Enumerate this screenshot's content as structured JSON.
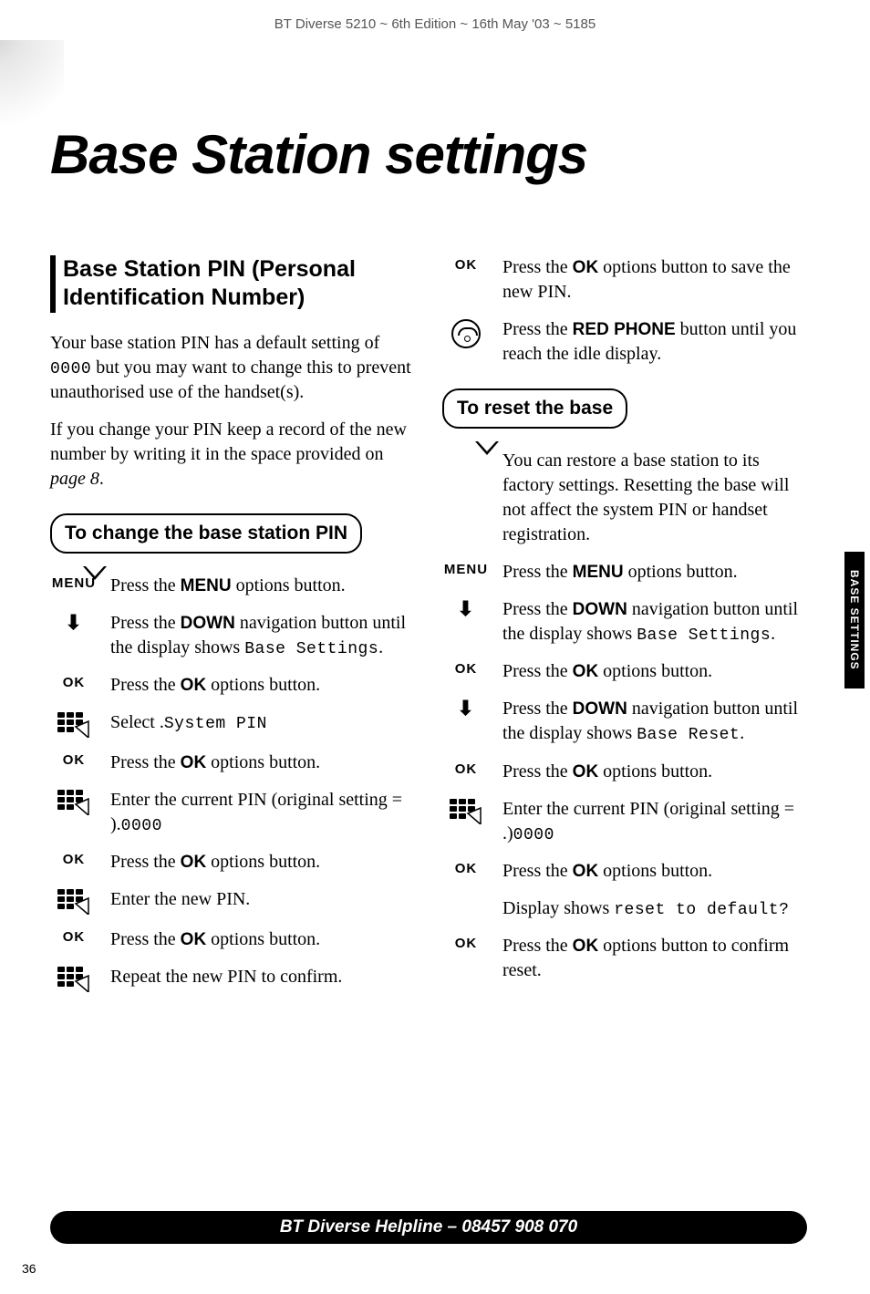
{
  "header": "BT Diverse 5210 ~ 6th Edition ~ 16th May '03 ~ 5185",
  "title": "Base Station settings",
  "side_tab": "BASE SETTINGS",
  "footer": "BT Diverse Helpline – 08457 908 070",
  "page_number": "36",
  "icon_labels": {
    "menu": "MENU",
    "ok": "OK"
  },
  "left": {
    "heading": "Base Station PIN (Personal Identification Number)",
    "para1_a": "Your base station PIN has a default setting of ",
    "para1_lcd": "0000",
    "para1_b": " but you may want to change this to prevent unauthorised use of the handset(s).",
    "para2_a": "If you change your PIN keep a record of the new number by writing it in the space provided on ",
    "para2_em": "page 8",
    "para2_b": ".",
    "callout": "To change the base station PIN",
    "steps": [
      {
        "icon": "menu",
        "text_a": "Press the ",
        "b": "MENU",
        "text_b": " options button."
      },
      {
        "icon": "down",
        "text_a": "Press the ",
        "b": "DOWN",
        "text_b": " navigation button until the display shows ",
        "lcd": "Base Settings",
        "text_c": "."
      },
      {
        "icon": "ok",
        "text_a": "Press the ",
        "b": "OK",
        "text_b": " options button."
      },
      {
        "icon": "keypad",
        "text_a": "Select ",
        "lcd": "System PIN",
        "text_b": "."
      },
      {
        "icon": "ok",
        "text_a": "Press the ",
        "b": "OK",
        "text_b": " options button."
      },
      {
        "icon": "keypad",
        "text_a": "Enter the current PIN (original setting = ",
        "lcd": "0000",
        "text_b": ")."
      },
      {
        "icon": "ok",
        "text_a": "Press the ",
        "b": "OK",
        "text_b": " options button."
      },
      {
        "icon": "keypad",
        "text_a": "Enter the new PIN."
      },
      {
        "icon": "ok",
        "text_a": "Press the ",
        "b": "OK",
        "text_b": " options button."
      },
      {
        "icon": "keypad",
        "text_a": "Repeat the new PIN to confirm."
      }
    ]
  },
  "right": {
    "top_steps": [
      {
        "icon": "ok",
        "text_a": "Press the ",
        "b": "OK",
        "text_b": " options button to save the new PIN."
      },
      {
        "icon": "redphone",
        "text_a": "Press the ",
        "b": "RED PHONE",
        "text_b": " button until you reach the idle display."
      }
    ],
    "callout": "To reset the base",
    "intro": "You can restore a base station to its factory settings. Resetting the base will not affect the system PIN or handset registration.",
    "steps": [
      {
        "icon": "menu",
        "text_a": "Press the ",
        "b": "MENU",
        "text_b": " options button."
      },
      {
        "icon": "down",
        "text_a": "Press the ",
        "b": "DOWN",
        "text_b": " navigation button until the display shows ",
        "lcd": "Base Settings",
        "text_c": "."
      },
      {
        "icon": "ok",
        "text_a": "Press the ",
        "b": "OK",
        "text_b": " options button."
      },
      {
        "icon": "down",
        "text_a": "Press the ",
        "b": "DOWN",
        "text_b": " navigation button until the display shows ",
        "lcd": "Base Reset",
        "text_c": "."
      },
      {
        "icon": "ok",
        "text_a": "Press the ",
        "b": "OK",
        "text_b": " options button."
      },
      {
        "icon": "keypad",
        "text_a": "Enter the current PIN (original setting = ",
        "lcd": "0000",
        "text_b": ".)"
      },
      {
        "icon": "ok",
        "text_a": "Press the ",
        "b": "OK",
        "text_b": " options button."
      },
      {
        "icon": "none",
        "text_a": "Display shows ",
        "lcd": "reset to default?"
      },
      {
        "icon": "ok",
        "text_a": "Press the ",
        "b": "OK",
        "text_b": " options button to confirm reset."
      }
    ]
  }
}
